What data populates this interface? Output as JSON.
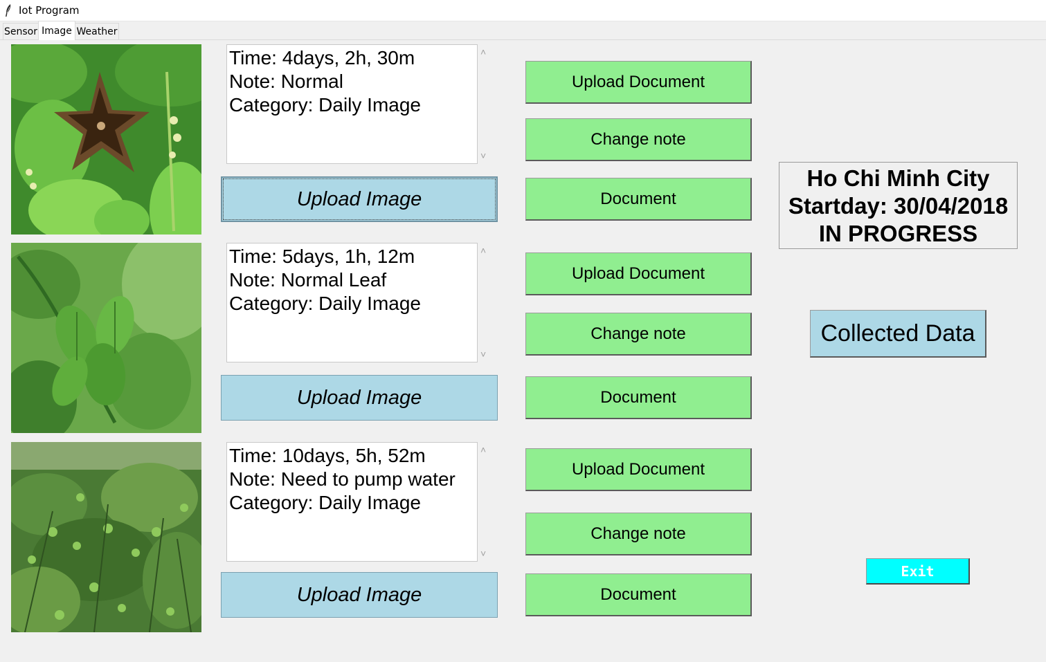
{
  "window": {
    "title": "Iot Program",
    "icon": "feather-icon"
  },
  "tabs": [
    {
      "label": "Sensor",
      "active": false
    },
    {
      "label": "Image",
      "active": true
    },
    {
      "label": "Weather",
      "active": false
    }
  ],
  "entries": [
    {
      "photo": "sacha-inchi-star-pod",
      "time": "Time: 4days, 2h, 30m",
      "note": "Note: Normal",
      "category": "Category: Daily Image",
      "upload_image_label": "Upload Image"
    },
    {
      "photo": "green-pods-on-vine",
      "time": "Time: 5days, 1h, 12m",
      "note": "Note: Normal Leaf",
      "category": "Category: Daily Image",
      "upload_image_label": "Upload Image"
    },
    {
      "photo": "field-of-plants",
      "time": "Time: 10days, 5h, 52m",
      "note": "Note: Need to pump water",
      "category": "Category: Daily Image",
      "upload_image_label": "Upload Image"
    }
  ],
  "action_buttons": {
    "upload_document": "Upload Document",
    "change_note": "Change note",
    "document": "Document"
  },
  "info": {
    "city": "Ho Chi Minh City",
    "startday": "Startday: 30/04/2018",
    "status": "IN PROGRESS"
  },
  "collected_data_label": "Collected Data",
  "exit_label": "Exit",
  "colors": {
    "upload_image_bg": "#add8e6",
    "green_button_bg": "#90ee90",
    "exit_bg": "#00ffff",
    "window_bg": "#f0f0f0"
  }
}
